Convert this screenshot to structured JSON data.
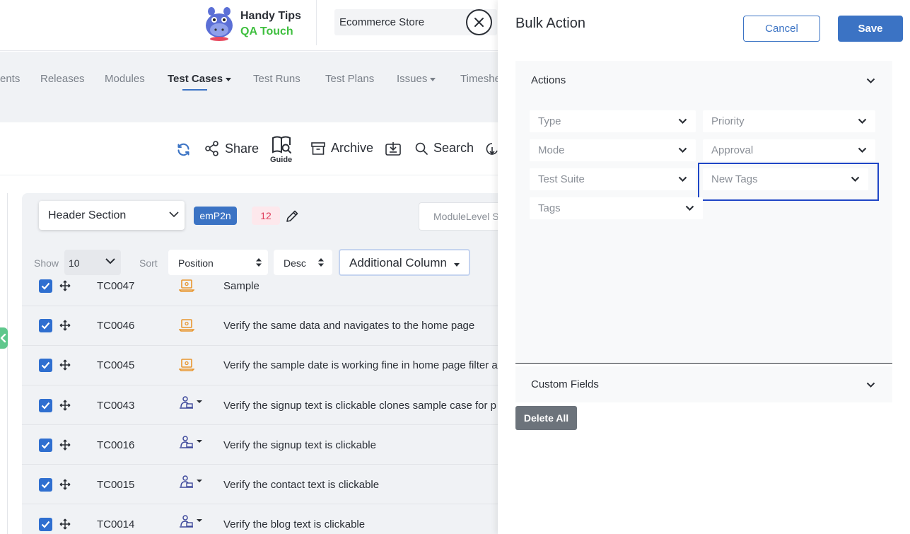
{
  "brand": {
    "line1": "Handy Tips",
    "line2": "QA Touch"
  },
  "project": {
    "name": "Ecommerce Store"
  },
  "nav": {
    "items": [
      {
        "label": "ents"
      },
      {
        "label": "Releases"
      },
      {
        "label": "Modules"
      },
      {
        "label": "Test Cases",
        "active": true,
        "dropdown": true
      },
      {
        "label": "Test Runs"
      },
      {
        "label": "Test Plans"
      },
      {
        "label": "Issues",
        "dropdown": true
      },
      {
        "label": "Timeshe"
      }
    ]
  },
  "toolbar": {
    "share": "Share",
    "guide": "Guide",
    "archive": "Archive",
    "search": "Search"
  },
  "list": {
    "section_select": "Header Section",
    "tag": "emP2n",
    "count": "12",
    "module_search_placeholder": "ModuleLevel S",
    "show_label": "Show",
    "show_value": "10",
    "sort_label": "Sort",
    "sort_value": "Position",
    "order_value": "Desc",
    "additional_column": "Additional Column"
  },
  "rows": [
    {
      "id": "TC0047",
      "title": "Sample",
      "icon": "laptop-icon",
      "checked": true
    },
    {
      "id": "TC0046",
      "title": "Verify the same data and navigates to the home page",
      "icon": "laptop-icon",
      "checked": true
    },
    {
      "id": "TC0045",
      "title": "Verify the sample date is working fine in home page filter a",
      "icon": "laptop-icon",
      "checked": true
    },
    {
      "id": "TC0043",
      "title": "Verify the signup text is clickable clones sample case for p",
      "icon": "manual-tester-icon",
      "checked": true
    },
    {
      "id": "TC0016",
      "title": "Verify the signup text is clickable",
      "icon": "manual-tester-icon",
      "checked": true
    },
    {
      "id": "TC0015",
      "title": "Verify the contact text is clickable",
      "icon": "manual-tester-icon",
      "checked": true
    },
    {
      "id": "TC0014",
      "title": "Verify the blog text is clickable",
      "icon": "manual-tester-icon",
      "checked": true
    }
  ],
  "bulk": {
    "title": "Bulk Action",
    "cancel": "Cancel",
    "save": "Save",
    "actions_title": "Actions",
    "fields": {
      "type": "Type",
      "priority": "Priority",
      "mode": "Mode",
      "approval": "Approval",
      "test_suite": "Test Suite",
      "new_tags": "New Tags",
      "tags": "Tags"
    },
    "custom_fields_title": "Custom Fields",
    "delete_all": "Delete All"
  },
  "colors": {
    "primary": "#3b73c4",
    "checkbox": "#2f6fd0",
    "brand_green": "#3fbf3f",
    "badge_pink_text": "#e0405e",
    "highlight_outline": "#1f46c6",
    "delete_button": "#6c737b"
  }
}
